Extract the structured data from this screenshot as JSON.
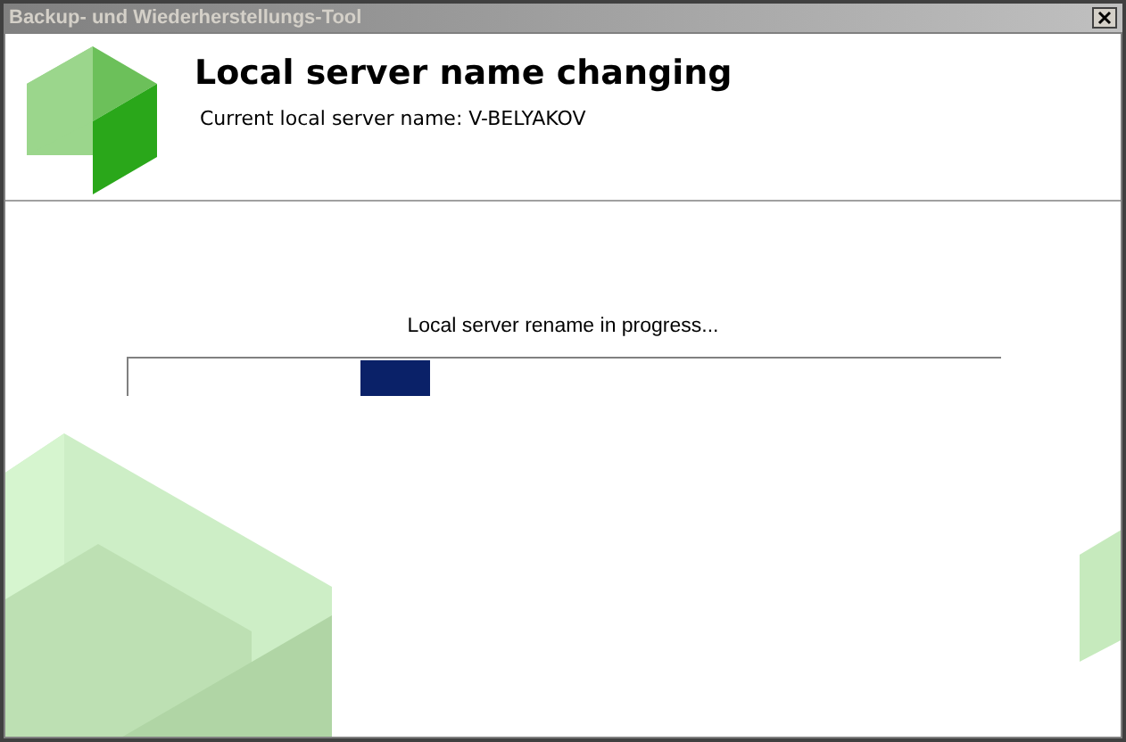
{
  "window": {
    "title": "Backup- und Wiederherstellungs-Tool"
  },
  "header": {
    "title": "Local server name changing",
    "subtitle": "Current local server name: V-BELYAKOV"
  },
  "status": {
    "text": "Local server rename in progress..."
  },
  "progress": {
    "level": 0.345
  }
}
